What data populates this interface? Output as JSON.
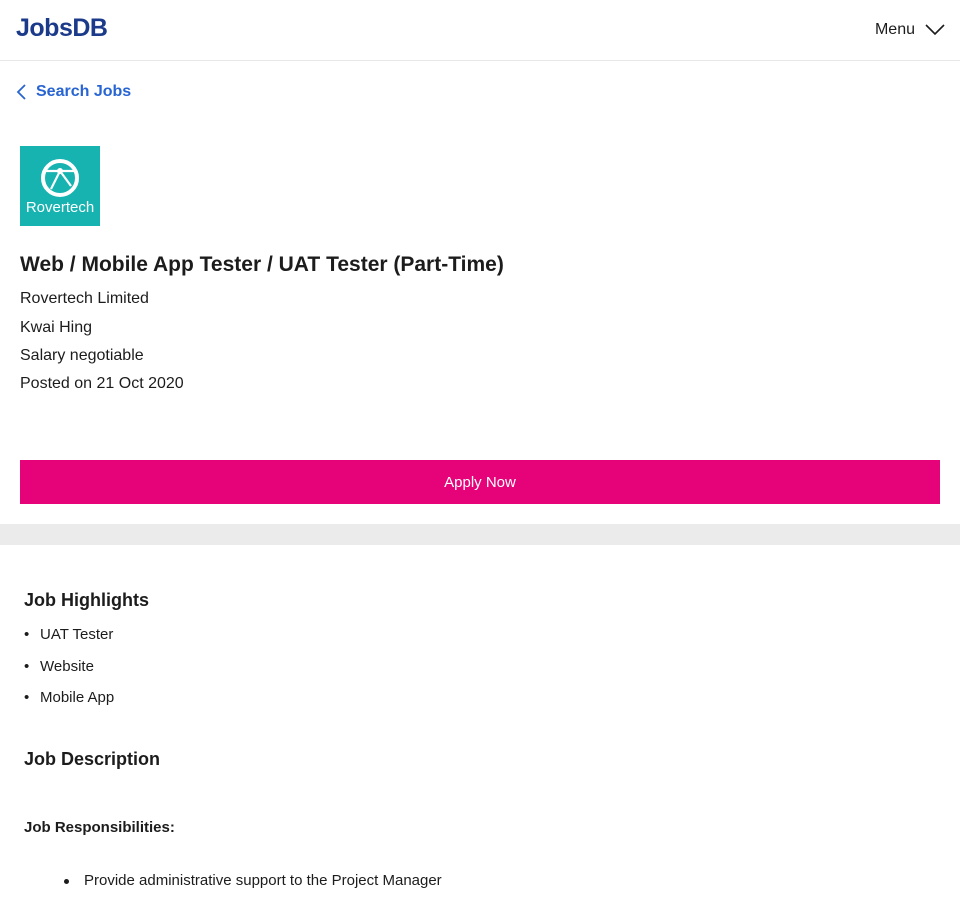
{
  "header": {
    "logo_text": "JobsDB",
    "menu_label": "Menu"
  },
  "nav": {
    "back_label": "Search Jobs"
  },
  "job": {
    "company_logo_text": "Rovertech",
    "title": "Web / Mobile App Tester / UAT Tester (Part-Time)",
    "company": "Rovertech Limited",
    "location": "Kwai Hing",
    "salary": "Salary negotiable",
    "posted": "Posted on 21 Oct 2020",
    "apply_label": "Apply Now"
  },
  "highlights": {
    "heading": "Job Highlights",
    "items": [
      "UAT Tester",
      "Website",
      "Mobile App"
    ]
  },
  "description": {
    "heading": "Job Description",
    "responsibilities_heading": "Job Responsibilities:",
    "responsibilities": [
      "Provide administrative support to the Project Manager"
    ]
  },
  "colors": {
    "brand": "#1b3a8a",
    "link": "#2864d2",
    "apply_button": "#e60278",
    "company_logo_bg": "#16b3b0",
    "divider": "#ebebeb"
  },
  "icons": {
    "menu": "chevron-down-icon",
    "back": "chevron-left-icon",
    "company": "rovertech-logo"
  }
}
